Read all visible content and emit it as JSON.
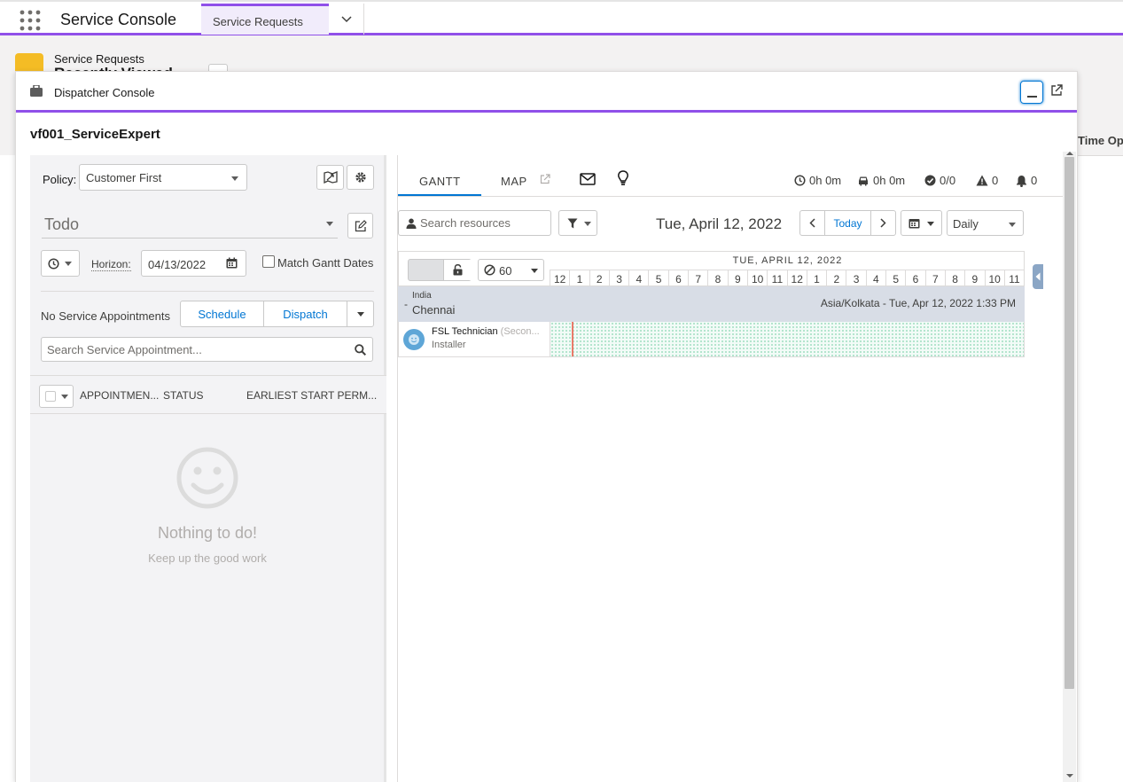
{
  "topnav": {
    "app_name": "Service Console",
    "tab_label": "Service Requests"
  },
  "background_page": {
    "object_label": "Service Requests",
    "list_title": "Recently Viewed",
    "column_header": "Time Open"
  },
  "utility": {
    "title": "Dispatcher Console"
  },
  "console": {
    "org_name": "vf001_ServiceExpert",
    "policy": {
      "label": "Policy:",
      "value": "Customer First"
    },
    "list_view": "Todo",
    "horizon": {
      "label": "Horizon:",
      "value": "04/13/2022"
    },
    "match_gantt_label": "Match Gantt Dates",
    "no_appointments": "No Service Appointments",
    "schedule_label": "Schedule",
    "dispatch_label": "Dispatch",
    "search_placeholder": "Search Service Appointment...",
    "columns": [
      "APPOINTMEN...",
      "STATUS",
      "EARLIEST START PERM..."
    ],
    "empty_title": "Nothing to do!",
    "empty_subtitle": "Keep up the good work"
  },
  "gantt": {
    "tab_gantt": "GANTT",
    "tab_map": "MAP",
    "stats": {
      "travel_time_scheduled": "0h 0m",
      "travel_time_driving": "0h 0m",
      "completed": "0/0",
      "rule_violations": "0",
      "notifications": "0"
    },
    "search_resources_placeholder": "Search resources",
    "current_date": "Tue, April 12, 2022",
    "today_label": "Today",
    "view_mode": "Daily",
    "zoom_value": "60",
    "day_header": "TUE, APRIL 12, 2022",
    "hours": [
      "12",
      "1",
      "2",
      "3",
      "4",
      "5",
      "6",
      "7",
      "8",
      "9",
      "10",
      "11",
      "12",
      "1",
      "2",
      "3",
      "4",
      "5",
      "6",
      "7",
      "8",
      "9",
      "10",
      "11"
    ],
    "region": {
      "country": "India",
      "city": "Chennai",
      "timezone": "Asia/Kolkata - Tue, Apr 12, 2022 1:33 PM"
    },
    "resource": {
      "name": "FSL Technician",
      "tag": "(Secon...",
      "role": "Installer"
    }
  },
  "icons": {
    "app_launcher": "waffle-grid-icon",
    "minimize": "minimize-icon",
    "popout": "external-link-icon"
  },
  "colors": {
    "accent": "#9050e9",
    "brand_blue": "#0176d3",
    "now_line": "#ea7a6a"
  }
}
